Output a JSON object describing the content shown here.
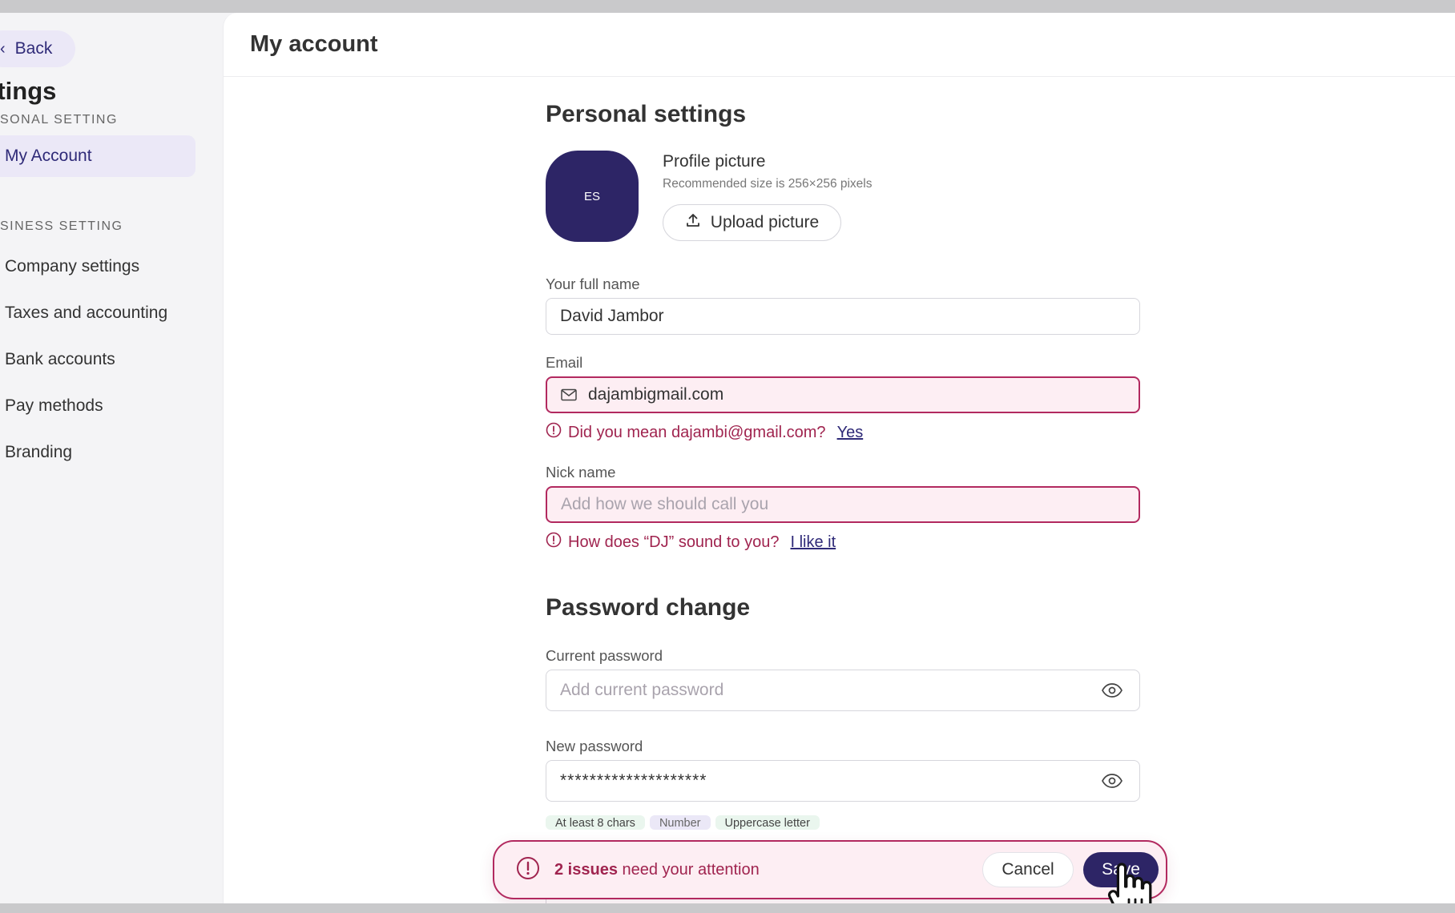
{
  "sidebar": {
    "back_label": "Back",
    "title": "ttings",
    "personal_section": "SONAL SETTING",
    "business_section": "SINESS SETTING",
    "items": [
      {
        "label": "My Account"
      },
      {
        "label": "Company settings"
      },
      {
        "label": "Taxes and accounting"
      },
      {
        "label": "Bank accounts"
      },
      {
        "label": "Pay methods"
      },
      {
        "label": "Branding"
      }
    ]
  },
  "header": {
    "title": "My account"
  },
  "personal": {
    "heading": "Personal settings",
    "avatar_initials": "ES",
    "profile_title": "Profile picture",
    "profile_sub": "Recommended size is 256×256 pixels",
    "upload_label": "Upload picture"
  },
  "fields": {
    "full_name_label": "Your full name",
    "full_name_value": "David Jambor",
    "email_label": "Email",
    "email_value": "dajambigmail.com",
    "email_hint": "Did you mean dajambi@gmail.com?",
    "email_hint_action": "Yes",
    "nick_label": "Nick name",
    "nick_placeholder": "Add how we should call you",
    "nick_hint": "How does “DJ” sound to you?",
    "nick_hint_action": "I like it"
  },
  "password": {
    "heading": "Password change",
    "current_label": "Current password",
    "current_placeholder": "Add current password",
    "new_label": "New password",
    "new_value": "********************",
    "chips": [
      "At least 8 chars",
      "Number",
      "Uppercase letter"
    ]
  },
  "toast": {
    "count": "2 issues",
    "text": " need your attention",
    "cancel_label": "Cancel",
    "save_label": "Save"
  },
  "colors": {
    "accent": "#2d2566",
    "error": "#b2295f",
    "error_bg": "#fdeef3",
    "nav_active_bg": "#ebe8f7"
  }
}
